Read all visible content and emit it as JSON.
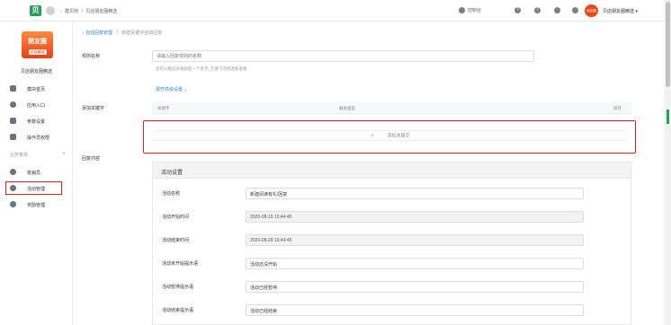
{
  "topbar": {
    "logo_text": "贝",
    "breadcrumb": [
      "群贝阿",
      "贝店朋友圈精选"
    ],
    "links": [
      "控制台"
    ],
    "user_name": "贝店朋友圈精选",
    "avatar_text": "朋友圈"
  },
  "sidebar": {
    "logo_line1": "朋友圈",
    "logo_line2": "贝店精选",
    "shop_name": "贝店朋友圈精选",
    "items": [
      {
        "label": "模块首页",
        "icon": "home-icon"
      },
      {
        "label": "应用入口",
        "icon": "app-entry-icon"
      },
      {
        "label": "参数设置",
        "icon": "settings-list-icon"
      },
      {
        "label": "操作员权限",
        "icon": "permission-icon"
      }
    ],
    "section_label": "业务菜单",
    "section_items": [
      {
        "label": "核销员",
        "icon": "gear-icon"
      },
      {
        "label": "活动管理",
        "icon": "gear-icon"
      },
      {
        "label": "奖励管理",
        "icon": "gear-icon"
      }
    ]
  },
  "main": {
    "breadcrumb_link": "自动回复管理",
    "breadcrumb_sep": "/",
    "breadcrumb_current": "新建关键字自动回复",
    "rule_name_label": "规则名称",
    "rule_name_placeholder": "请输入回复规则的名称",
    "rule_name_hint": "您可以给这条规则起一个名字, 方便下次修改和查看",
    "advanced_label": "展开高级设置",
    "keyword_label": "添加关键字",
    "keyword_columns": [
      "关键字",
      "触发类型",
      "操作"
    ],
    "add_keyword_label": "添加关键字",
    "reply_label": "回复内容",
    "panel_title": "活动设置",
    "fields": [
      {
        "label": "活动名称",
        "value": "新建阅读有礼/回复",
        "readonly": false
      },
      {
        "label": "活动开始时间",
        "value": "2020-08-19 10:44:45",
        "readonly": true
      },
      {
        "label": "活动结束时间",
        "value": "2020-08-29 10:44:45",
        "readonly": true
      },
      {
        "label": "活动未开始提示语",
        "value": "活动还没开始",
        "readonly": false
      },
      {
        "label": "活动暂停提示语",
        "value": "活动已经暂停",
        "readonly": false
      },
      {
        "label": "活动结束提示语",
        "value": "活动已经结束",
        "readonly": false
      }
    ]
  },
  "colors": {
    "accent": "#3a86d9",
    "highlight": "#e02020",
    "brand": "#2d9c5a"
  }
}
